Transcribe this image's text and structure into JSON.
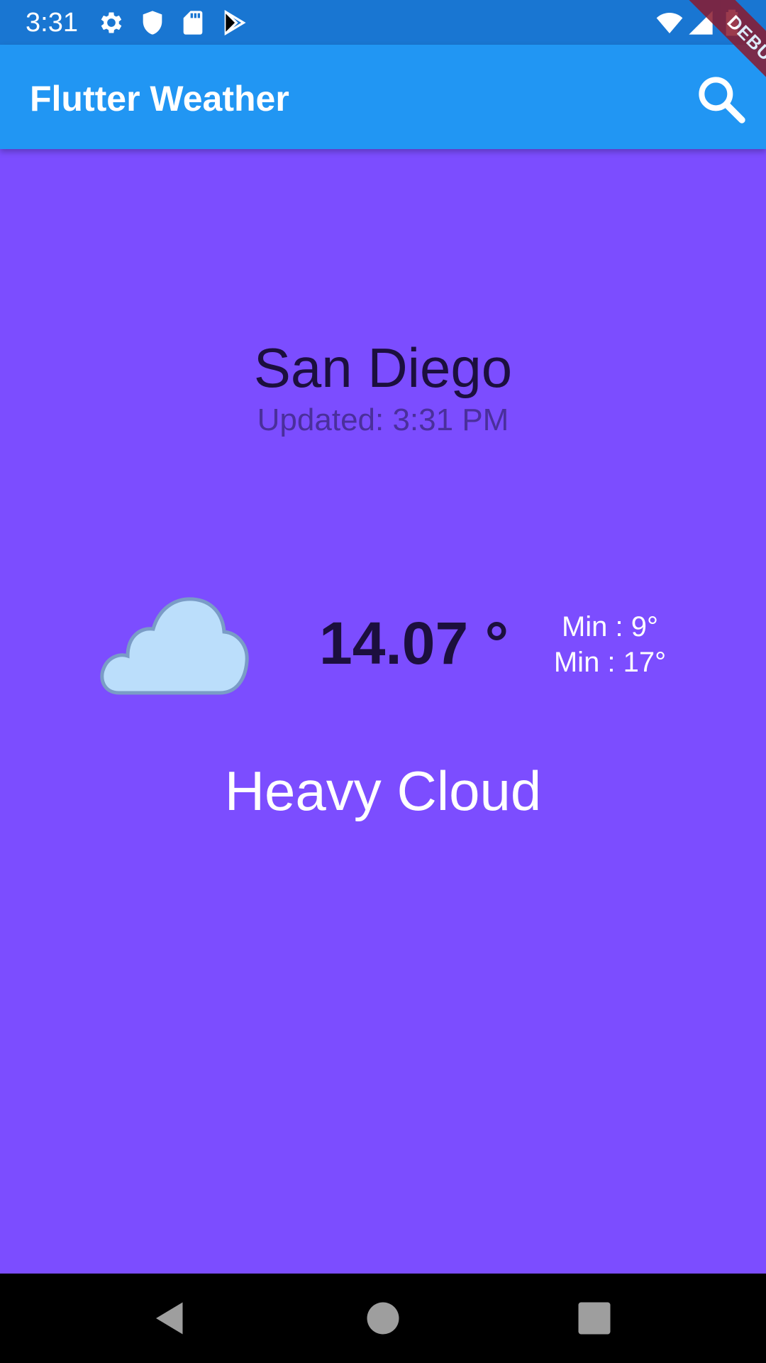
{
  "status_bar": {
    "time": "3:31",
    "icons": [
      "gear-icon",
      "shield-icon",
      "sd-card-icon",
      "play-store-icon",
      "wifi-icon",
      "signal-icon",
      "battery-icon"
    ]
  },
  "app_bar": {
    "title": "Flutter Weather",
    "search_icon": "search-icon",
    "debug_banner": "DEBUG"
  },
  "weather": {
    "city": "San Diego",
    "updated": "Updated: 3:31 PM",
    "temperature": "14.07 °",
    "min_label": "Min : 9°",
    "max_label": "Min : 17°",
    "condition": "Heavy Cloud",
    "condition_icon": "cloud-icon"
  },
  "nav_bar": {
    "buttons": [
      "back-icon",
      "home-icon",
      "recents-icon"
    ]
  },
  "colors": {
    "status_bar": "#1976d2",
    "app_bar": "#2196f3",
    "background": "#7c4dff",
    "nav_bar": "#000000"
  }
}
